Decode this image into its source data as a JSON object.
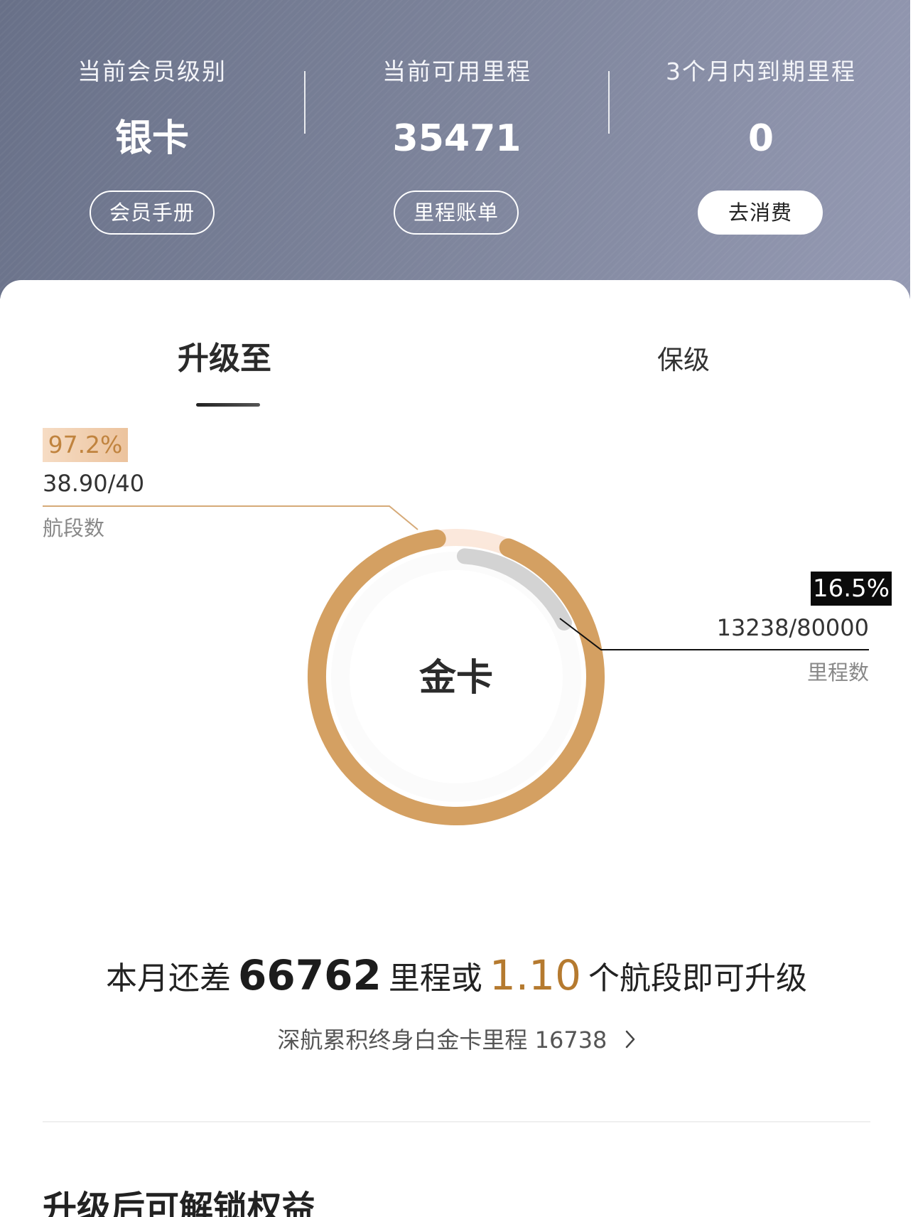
{
  "header": {
    "stats": [
      {
        "label": "当前会员级别",
        "value": "银卡"
      },
      {
        "label": "当前可用里程",
        "value": "35471"
      },
      {
        "label": "3个月内到期里程",
        "value": "0"
      }
    ],
    "buttons": [
      {
        "label": "会员手册"
      },
      {
        "label": "里程账单"
      },
      {
        "label": "去消费"
      }
    ]
  },
  "tabs": [
    {
      "label": "升级至",
      "active": true
    },
    {
      "label": "保级",
      "active": false
    }
  ],
  "progress": {
    "target_tier": "金卡",
    "segments": {
      "percent_label": "97.2%",
      "ratio_label": "38.90/40",
      "name": "航段数",
      "fraction": 0.972,
      "color": "#d4a062"
    },
    "mileage": {
      "percent_label": "16.5%",
      "ratio_label": "13238/80000",
      "name": "里程数",
      "fraction": 0.165,
      "color": "#d3d3d3"
    },
    "track_color": "#f8e4d6"
  },
  "summary": {
    "prefix": "本月还差",
    "miles_needed": "66762",
    "middle": "里程或",
    "segments_needed": "1.10",
    "suffix": "个航段即可升级"
  },
  "lifetime": {
    "label": "深航累积终身白金卡里程",
    "value": "16738"
  },
  "section": {
    "title": "升级后可解锁权益"
  },
  "icons": {
    "chevron": "chevron-right-icon"
  },
  "colors": {
    "header_start": "#687088",
    "header_end": "#959ab3",
    "gold_text": "#b57a2f",
    "gold_ring": "#d4a062"
  }
}
